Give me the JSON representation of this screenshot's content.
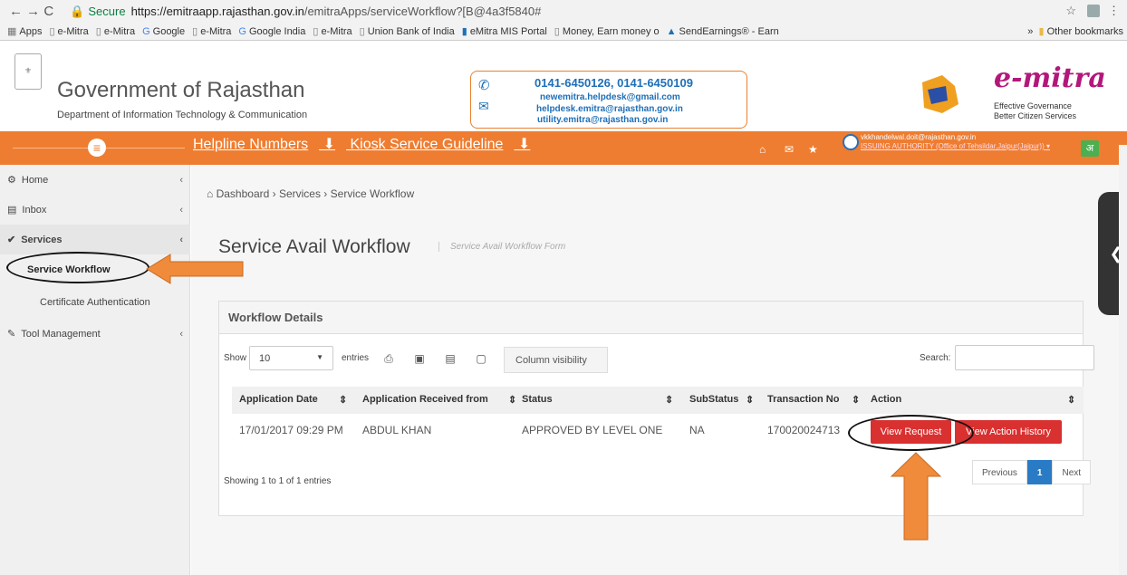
{
  "browser": {
    "secure_label": "Secure",
    "url_host": "https://emitraapp.rajasthan.gov.in",
    "url_path": "/emitraApps/serviceWorkflow?[B@4a3f5840#",
    "bookmarks": [
      "Apps",
      "e-Mitra",
      "e-Mitra",
      "Google",
      "e-Mitra",
      "Google India",
      "e-Mitra",
      "Union Bank of India",
      "eMitra MIS Portal",
      "Money, Earn money o",
      "SendEarnings® - Earn"
    ],
    "other_bookmarks": "Other bookmarks"
  },
  "header": {
    "gov_title": "Government of Rajasthan",
    "dept": "Department of Information Technology & Communication",
    "phones": "0141-6450126, 0141-6450109",
    "emails": [
      "newemitra.helpdesk@gmail.com",
      "helpdesk.emitra@rajasthan.gov.in",
      "utility.emitra@rajasthan.gov.in"
    ],
    "logo_text": "e-mitra",
    "tagline1": "Effective Governance",
    "tagline2": "Better Citizen Services"
  },
  "nav": {
    "helpline": "Helpline Numbers",
    "guideline": "Kiosk Service Guideline",
    "user_email": "vkkhandelwal.doit@rajasthan.gov.in",
    "user_role": "ISSUING AUTHORITY (Office of Tehsildar,Jaipur(Jaipur)) ▾",
    "lang": "अ"
  },
  "sidebar": {
    "home": "Home",
    "inbox": "Inbox",
    "services": "Services",
    "service_workflow": "Service Workflow",
    "certificate_auth": "Certificate Authentication",
    "tool_mgmt": "Tool Management"
  },
  "main": {
    "breadcrumb": "Dashboard › Services › Service Workflow",
    "title": "Service Avail Workflow",
    "subtitle": "Service Avail Workflow Form",
    "panel_title": "Workflow Details",
    "show": "Show",
    "entries_value": "10",
    "entries": "entries",
    "column_visibility": "Column visibility",
    "search": "Search:",
    "columns": [
      "Application Date",
      "Application Received from",
      "Status",
      "SubStatus",
      "Transaction No",
      "Action"
    ],
    "row": {
      "date": "17/01/2017 09:29 PM",
      "from": "ABDUL KHAN",
      "status": "APPROVED BY LEVEL ONE",
      "substatus": "NA",
      "txn": "170020024713",
      "view_request": "View Request",
      "view_history": "View Action History"
    },
    "info": "Showing 1 to 1 of 1 entries",
    "prev": "Previous",
    "page": "1",
    "next": "Next"
  }
}
